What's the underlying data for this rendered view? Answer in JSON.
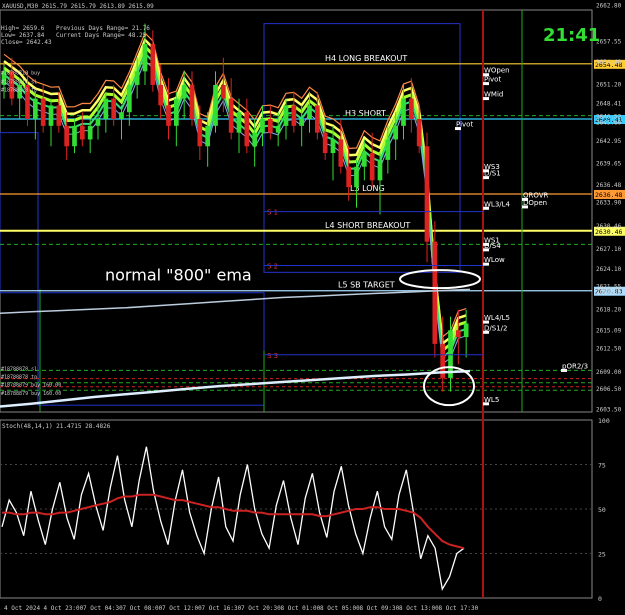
{
  "window": {
    "symbol_title": "XAUUSD,M30",
    "info_line1": "XAUUSD,M30 2615.79 2615.79 2613.89 2615.09",
    "info_high": "High= 2659.6",
    "info_low": "Low= 2637.84",
    "info_close": "Close= 2642.43",
    "info_prev_range": "Previous Days Range= 21.76",
    "info_curr_range": "Current Days Range= 48.25",
    "clock": "21:41",
    "annotation": "normal \"800\" ema"
  },
  "levels": [
    {
      "label": "H4 LONG BREAKOUT",
      "price": 2654.1,
      "color": "#ffffff",
      "tag": "2654.48",
      "tag_color": "#ffcc33"
    },
    {
      "label": "H3 SHORT",
      "price": 2646.0,
      "color": "#ffffff",
      "tag": "2648.41",
      "tag_color": "#33ccff"
    },
    {
      "label": "L3 LONG",
      "price": 2635.0,
      "color": "#ffffff",
      "tag": "2636.48",
      "tag_color": "#ff9933"
    },
    {
      "label": "L4 SHORT BREAKOUT",
      "price": 2629.6,
      "color": "#ffffff",
      "tag": "2630.46",
      "tag_color": "#ffff66"
    },
    {
      "label": "L5 SB TARGET",
      "price": 2620.8,
      "color": "#ffffff",
      "tag": "2620.83",
      "tag_color": "#aaddff"
    }
  ],
  "pivots": [
    {
      "label": "WOpen",
      "price": 2652.5
    },
    {
      "label": "Pivot",
      "price": 2651.2
    },
    {
      "label": "WMid",
      "price": 2649.0
    },
    {
      "label": "Pivot",
      "price": 2644.6
    },
    {
      "label": "WS3",
      "price": 2638.4
    },
    {
      "label": "D/S1",
      "price": 2637.4
    },
    {
      "label": "WL3/L4",
      "price": 2632.9
    },
    {
      "label": "OROVR",
      "price": 2634.2
    },
    {
      "label": "DOpen",
      "price": 2633.1
    },
    {
      "label": "WS1",
      "price": 2627.6
    },
    {
      "label": "D/S4",
      "price": 2626.8
    },
    {
      "label": "WLow",
      "price": 2624.7
    },
    {
      "label": "WL4/L5",
      "price": 2616.2
    },
    {
      "label": "D/S1/2",
      "price": 2614.7
    },
    {
      "label": "pOR2/3",
      "price": 2609.1
    },
    {
      "label": "WL5",
      "price": 2604.2
    }
  ],
  "s_labels": [
    "S 1",
    "S 2",
    "S 3"
  ],
  "order_labels": [
    "#18788878 sl",
    "#18788878 tp",
    "#18788879 buy 160.00",
    "#18788879 buy 160.00"
  ],
  "left_labels": [
    "#18788718 buy",
    "#18788718 sl",
    "#18788828 tp"
  ],
  "chart_data": [
    {
      "type": "line",
      "title": "XAUUSD,M30",
      "ylim": [
        2603,
        2662
      ],
      "y_ticks": [
        "2662.80",
        "2657.55",
        "2654.48",
        "2651.20",
        "2648.41",
        "2646.52",
        "2645.60",
        "2642.95",
        "2639.65",
        "2636.48",
        "2633.90",
        "2630.46",
        "2627.10",
        "2624.10",
        "2621.55",
        "2620.83",
        "2618.20",
        "2615.09",
        "2612.50",
        "2609.00",
        "2606.50",
        "2603.50"
      ],
      "x_ticks": [
        "4 Oct 2024",
        "4 Oct 23:00",
        "7 Oct 04:30",
        "7 Oct 08:00",
        "7 Oct 12:00",
        "7 Oct 16:30",
        "7 Oct 20:30",
        "8 Oct 01:00",
        "8 Oct 05:00",
        "8 Oct 09:30",
        "8 Oct 13:00",
        "8 Oct 17:30"
      ],
      "candles": [
        [
          2651,
          2654,
          2649,
          2653
        ],
        [
          2653,
          2655,
          2648,
          2649
        ],
        [
          2649,
          2652,
          2646,
          2651
        ],
        [
          2651,
          2653,
          2645,
          2646
        ],
        [
          2646,
          2650,
          2643,
          2649
        ],
        [
          2649,
          2651,
          2644,
          2645
        ],
        [
          2645,
          2649,
          2642,
          2648
        ],
        [
          2648,
          2650,
          2644,
          2645
        ],
        [
          2645,
          2647,
          2640,
          2642
        ],
        [
          2642,
          2646,
          2641,
          2645
        ],
        [
          2645,
          2647,
          2642,
          2643
        ],
        [
          2643,
          2646,
          2641,
          2645
        ],
        [
          2645,
          2648,
          2643,
          2646
        ],
        [
          2646,
          2650,
          2644,
          2649
        ],
        [
          2649,
          2651,
          2645,
          2646
        ],
        [
          2646,
          2648,
          2643,
          2647
        ],
        [
          2647,
          2652,
          2645,
          2651
        ],
        [
          2651,
          2655,
          2649,
          2653
        ],
        [
          2653,
          2660,
          2651,
          2657
        ],
        [
          2657,
          2659,
          2650,
          2651
        ],
        [
          2651,
          2654,
          2646,
          2648
        ],
        [
          2648,
          2652,
          2643,
          2645
        ],
        [
          2645,
          2650,
          2642,
          2649
        ],
        [
          2649,
          2653,
          2646,
          2651
        ],
        [
          2651,
          2653,
          2645,
          2646
        ],
        [
          2646,
          2648,
          2640,
          2642
        ],
        [
          2642,
          2647,
          2639,
          2645
        ],
        [
          2645,
          2653,
          2644,
          2651
        ],
        [
          2651,
          2655,
          2647,
          2649
        ],
        [
          2649,
          2652,
          2643,
          2644
        ],
        [
          2644,
          2649,
          2641,
          2647
        ],
        [
          2647,
          2649,
          2641,
          2642
        ],
        [
          2642,
          2646,
          2639,
          2644
        ],
        [
          2644,
          2648,
          2642,
          2646
        ],
        [
          2646,
          2648,
          2643,
          2644
        ],
        [
          2644,
          2647,
          2642,
          2645
        ],
        [
          2645,
          2649,
          2643,
          2648
        ],
        [
          2648,
          2650,
          2644,
          2645
        ],
        [
          2645,
          2648,
          2642,
          2646
        ],
        [
          2646,
          2650,
          2644,
          2648
        ],
        [
          2648,
          2650,
          2643,
          2644
        ],
        [
          2644,
          2646,
          2640,
          2641
        ],
        [
          2641,
          2645,
          2637,
          2643
        ],
        [
          2643,
          2646,
          2638,
          2639
        ],
        [
          2639,
          2642,
          2634,
          2636
        ],
        [
          2636,
          2640,
          2633,
          2639
        ],
        [
          2639,
          2643,
          2637,
          2641
        ],
        [
          2641,
          2644,
          2636,
          2637
        ],
        [
          2637,
          2641,
          2632,
          2640
        ],
        [
          2640,
          2645,
          2638,
          2643
        ],
        [
          2643,
          2647,
          2640,
          2645
        ],
        [
          2645,
          2651,
          2643,
          2649
        ],
        [
          2649,
          2652,
          2644,
          2646
        ],
        [
          2646,
          2648,
          2641,
          2642
        ],
        [
          2642,
          2644,
          2625,
          2628
        ],
        [
          2628,
          2631,
          2611,
          2613
        ],
        [
          2613,
          2617,
          2606,
          2608
        ],
        [
          2608,
          2617,
          2606,
          2615
        ],
        [
          2615,
          2618,
          2610,
          2614
        ],
        [
          2614,
          2618,
          2611,
          2616
        ]
      ],
      "ema_800": [
        2617.5,
        2617.7,
        2617.9,
        2618.1,
        2618.3,
        2618.6,
        2618.9,
        2619.2,
        2619.5,
        2619.8,
        2620.0,
        2620.2,
        2620.4,
        2620.6,
        2620.8,
        2621.0
      ],
      "ema_lower": [
        2603.8,
        2604.2,
        2604.7,
        2605.2,
        2605.6,
        2606.0,
        2606.4,
        2606.8,
        2607.1,
        2607.4,
        2607.7,
        2608.0,
        2608.3,
        2608.5,
        2608.8,
        2609.0
      ]
    },
    {
      "type": "line",
      "title": "Stoch(48,14,1) 21.4715 28.4826",
      "ylim": [
        0,
        100
      ],
      "y_ticks": [
        "100",
        "75",
        "50",
        "25",
        "0"
      ],
      "series": [
        {
          "values": [
            40,
            55,
            48,
            35,
            60,
            44,
            30,
            50,
            65,
            45,
            33,
            58,
            70,
            52,
            38,
            62,
            80,
            55,
            40,
            66,
            85,
            60,
            43,
            30,
            55,
            72,
            48,
            35,
            25,
            50,
            68,
            40,
            32,
            58,
            75,
            50,
            36,
            28,
            52,
            66,
            45,
            30,
            56,
            70,
            48,
            34,
            60,
            74,
            52,
            36,
            25,
            45,
            60,
            40,
            33,
            58,
            72,
            48,
            22,
            35,
            28,
            5,
            12,
            25,
            28
          ]
        },
        {
          "values": [
            48,
            48,
            47,
            47,
            48,
            48,
            47,
            47,
            48,
            48,
            49,
            50,
            51,
            52,
            53,
            54,
            56,
            57,
            57,
            58,
            58,
            58,
            57,
            56,
            55,
            55,
            54,
            53,
            52,
            51,
            51,
            50,
            49,
            49,
            49,
            48,
            48,
            47,
            47,
            47,
            47,
            47,
            47,
            47,
            46,
            46,
            47,
            48,
            49,
            50,
            50,
            51,
            51,
            50,
            50,
            50,
            49,
            48,
            45,
            40,
            36,
            32,
            30,
            29,
            28
          ]
        }
      ]
    }
  ]
}
